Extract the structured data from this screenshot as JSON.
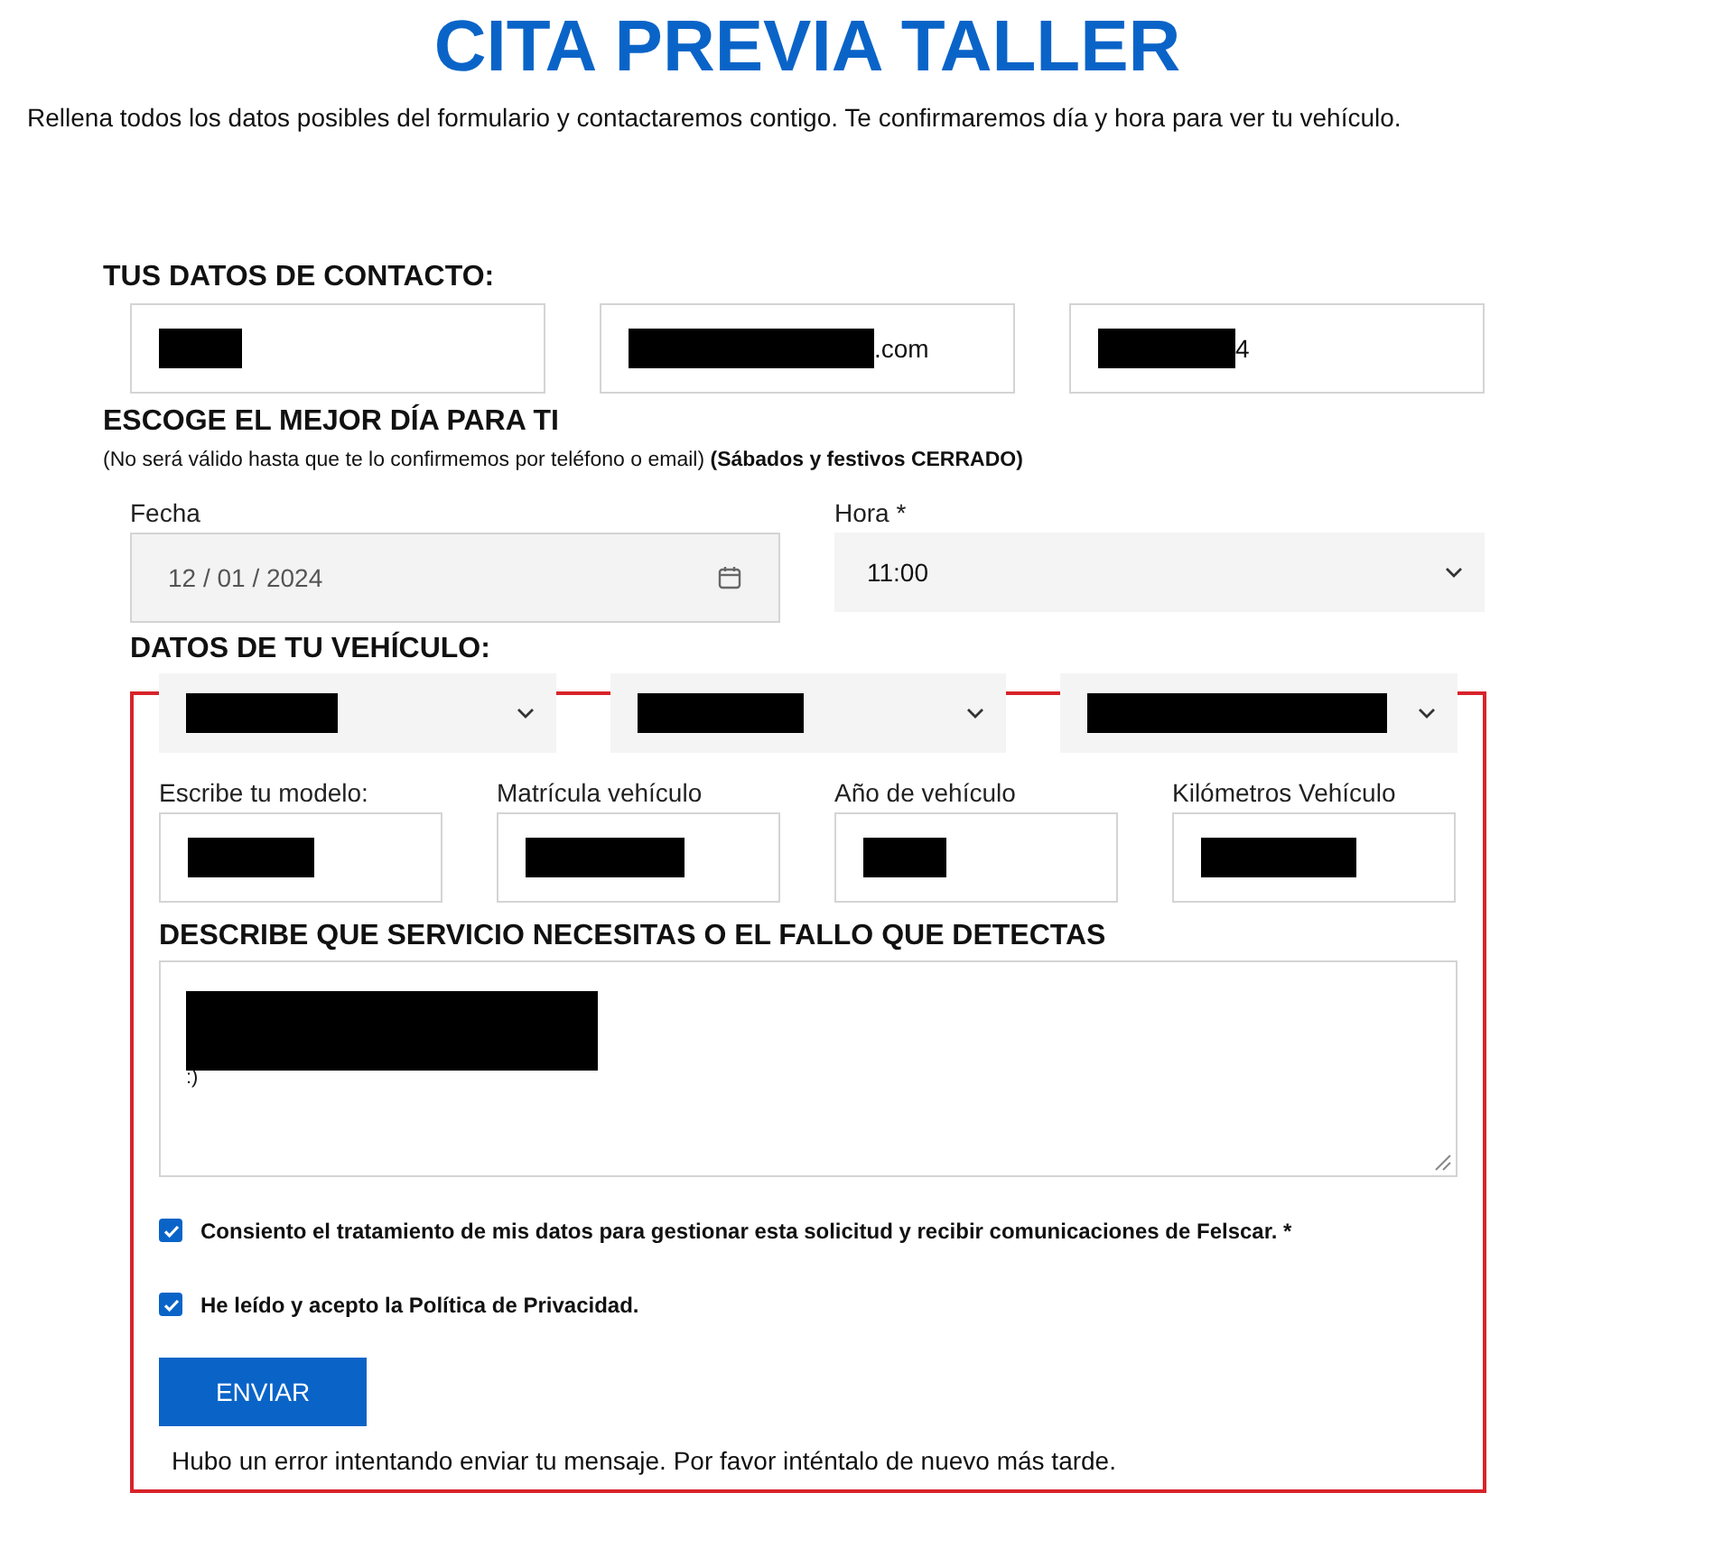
{
  "title": "CITA PREVIA TALLER",
  "intro": "Rellena todos los datos posibles del formulario y contactaremos contigo. Te confirmaremos día y hora para ver tu vehículo.",
  "contact": {
    "heading": "TUS DATOS DE CONTACTO:",
    "fields": [
      {
        "redacted": true
      },
      {
        "redacted": true,
        "value": ".com"
      },
      {
        "redacted": true,
        "value": "4"
      }
    ]
  },
  "schedule": {
    "heading": "ESCOGE EL MEJOR DÍA PARA TI",
    "note": "(No será válido hasta que te lo confirmemos por teléfono o email) **(Sábados y festivos CERRADO)**",
    "date": {
      "label": "Fecha",
      "value": "12 / 01 / 2024",
      "disabled": true
    },
    "time": {
      "label": "Hora *",
      "value": "11:00"
    }
  },
  "vehicle": {
    "heading": "DATOS DE TU VEHÍCULO:",
    "invalid": true,
    "selects": [
      {
        "redacted": true
      },
      {
        "redacted": true
      },
      {
        "redacted": true
      }
    ],
    "fields": [
      {
        "label": "Escribe tu modelo:",
        "redacted": true
      },
      {
        "label": "Matrícula vehículo",
        "redacted": true
      },
      {
        "label": "Año de vehículo",
        "redacted": true
      },
      {
        "label": "Kilómetros Vehículo",
        "redacted": true
      }
    ],
    "description": {
      "heading": "DESCRIBE QUE SERVICIO NECESITAS O EL FALLO QUE DETECTAS",
      "redacted": true,
      "value": ":)"
    },
    "consents": [
      {
        "label": "Consiento el tratamiento de mis datos para gestionar esta solicitud y recibir comunicaciones de Felscar. *",
        "checked": true
      },
      {
        "label": "He leído y acepto la Política de Privacidad.",
        "checked": true
      }
    ],
    "submit": "ENVIAR",
    "error": "Hubo un error intentando enviar tu mensaje. Por favor inténtalo de nuevo más tarde."
  }
}
